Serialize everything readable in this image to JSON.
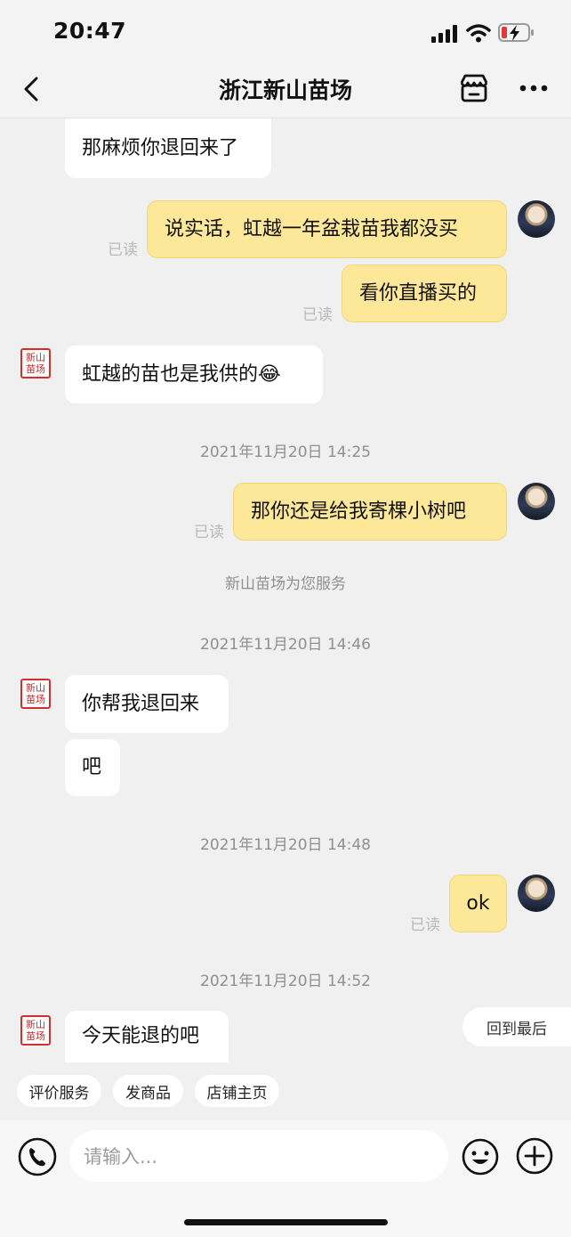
{
  "status_bar": {
    "time": "20:47"
  },
  "header": {
    "title": "浙江新山苗场"
  },
  "shop_avatar_text": "新山苗场",
  "messages": {
    "m1": "那麻烦你退回来了",
    "m2": "说实话，虹越一年盆栽苗我都没买",
    "m3": "看你直播买的",
    "m4": "虹越的苗也是我供的😂",
    "m5": "那你还是给我寄棵小树吧",
    "m6": "你帮我退回来",
    "m7": "吧",
    "m8": "ok",
    "m9": "今天能退的吧"
  },
  "read_label": "已读",
  "timestamps": {
    "t1": "2021年11月20日 14:25",
    "t2": "2021年11月20日 14:46",
    "t3": "2021年11月20日 14:48",
    "t4": "2021年11月20日 14:52"
  },
  "system_notice": "新山苗场为您服务",
  "back_to_latest": "回到最后",
  "quick_actions": {
    "rate": "评价服务",
    "send_product": "发商品",
    "shop_home": "店铺主页"
  },
  "composer": {
    "placeholder": "请输入..."
  }
}
